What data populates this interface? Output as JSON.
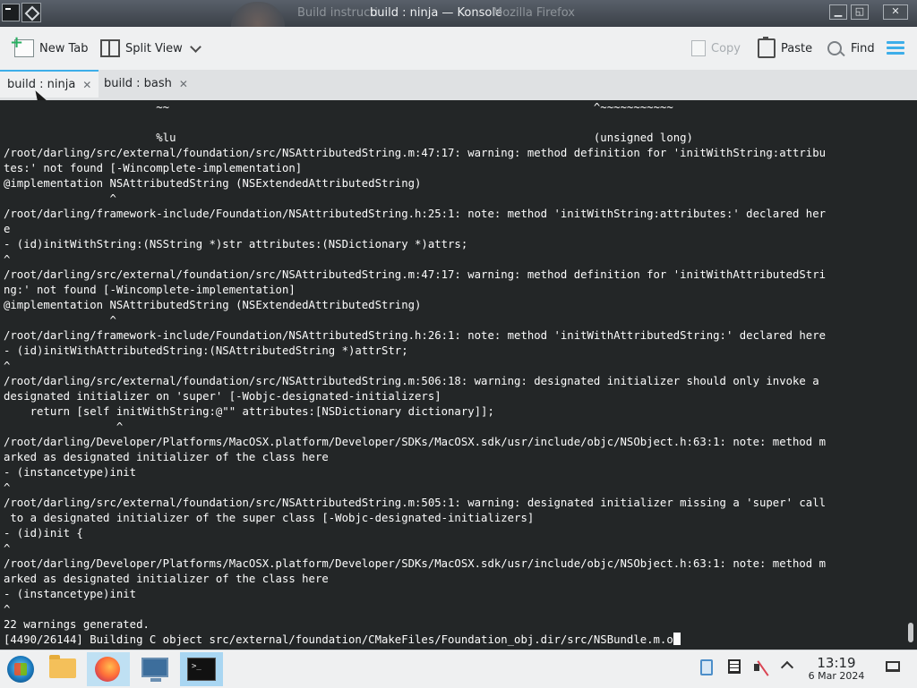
{
  "window": {
    "title_ghost": "Build instructi",
    "title": "build : ninja — Konsole",
    "title_ghost2": "Mozilla Firefox",
    "minimize": "▁",
    "maximize": "◱",
    "close": "✕"
  },
  "toolbar": {
    "new_tab": "New Tab",
    "split_view": "Split View",
    "copy": "Copy",
    "paste": "Paste",
    "find": "Find"
  },
  "tabs": [
    {
      "label": "build : ninja",
      "close": "✕"
    },
    {
      "label": "build : bash",
      "close": "✕"
    }
  ],
  "terminal": {
    "lines": [
      "                       ~~                                                                ^~~~~~~~~~~~",
      "",
      "                       %lu                                                               (unsigned long)",
      "/root/darling/src/external/foundation/src/NSAttributedString.m:47:17: warning: method definition for 'initWithString:attribu",
      "tes:' not found [-Wincomplete-implementation]",
      "@implementation NSAttributedString (NSExtendedAttributedString)",
      "                ^",
      "/root/darling/framework-include/Foundation/NSAttributedString.h:25:1: note: method 'initWithString:attributes:' declared her",
      "e",
      "- (id)initWithString:(NSString *)str attributes:(NSDictionary *)attrs;",
      "^",
      "/root/darling/src/external/foundation/src/NSAttributedString.m:47:17: warning: method definition for 'initWithAttributedStri",
      "ng:' not found [-Wincomplete-implementation]",
      "@implementation NSAttributedString (NSExtendedAttributedString)",
      "                ^",
      "/root/darling/framework-include/Foundation/NSAttributedString.h:26:1: note: method 'initWithAttributedString:' declared here",
      "- (id)initWithAttributedString:(NSAttributedString *)attrStr;",
      "^",
      "/root/darling/src/external/foundation/src/NSAttributedString.m:506:18: warning: designated initializer should only invoke a",
      "designated initializer on 'super' [-Wobjc-designated-initializers]",
      "    return [self initWithString:@\"\" attributes:[NSDictionary dictionary]];",
      "                 ^",
      "/root/darling/Developer/Platforms/MacOSX.platform/Developer/SDKs/MacOSX.sdk/usr/include/objc/NSObject.h:63:1: note: method m",
      "arked as designated initializer of the class here",
      "- (instancetype)init",
      "^",
      "/root/darling/src/external/foundation/src/NSAttributedString.m:505:1: warning: designated initializer missing a 'super' call",
      " to a designated initializer of the super class [-Wobjc-designated-initializers]",
      "- (id)init {",
      "^",
      "/root/darling/Developer/Platforms/MacOSX.platform/Developer/SDKs/MacOSX.sdk/usr/include/objc/NSObject.h:63:1: note: method m",
      "arked as designated initializer of the class here",
      "- (instancetype)init",
      "^",
      "22 warnings generated."
    ],
    "status_line": "[4490/26144] Building C object src/external/foundation/CMakeFiles/Foundation_obj.dir/src/NSBundle.m.o"
  },
  "taskbar": {
    "konsole_label": ">_",
    "time": "13:19",
    "date": "6 Mar 2024"
  },
  "colors": {
    "accent": "#3daee9",
    "terminal_bg": "#232627",
    "terminal_fg": "#fcfcfc"
  }
}
